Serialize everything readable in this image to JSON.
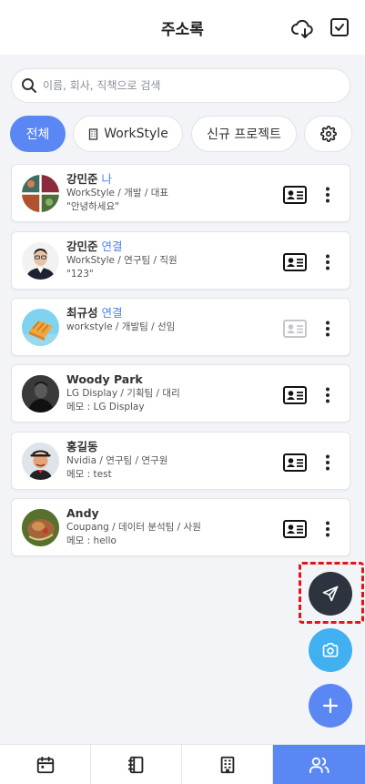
{
  "header": {
    "title": "주소록"
  },
  "search": {
    "placeholder": "이름, 회사, 직책으로 검색"
  },
  "filters": [
    {
      "label": "전체",
      "active": true
    },
    {
      "label": "WorkStyle",
      "icon": "building-icon",
      "active": false
    },
    {
      "label": "신규 프로젝트",
      "active": false
    },
    {
      "icon": "gear-icon",
      "active": false
    }
  ],
  "contacts": [
    {
      "name": "강민준",
      "tag": "나",
      "line1": "WorkStyle / 개발 / 대표",
      "line2": "\"안녕하세요\"",
      "avatar": "pattern",
      "card_enabled": true
    },
    {
      "name": "강민준",
      "tag": "연결",
      "line1": "WorkStyle / 연구팀 / 직원",
      "line2": "\"123\"",
      "avatar": "man-photo",
      "card_enabled": true
    },
    {
      "name": "최규성",
      "tag": "연결",
      "line1": "workstyle / 개발팀 / 선임",
      "line2": "",
      "avatar": "food-photo",
      "card_enabled": false
    },
    {
      "name": "Woody Park",
      "tag": "",
      "line1": "LG Display / 기획팀 / 대리",
      "line2": "메모 : LG Display",
      "avatar": "dark-photo",
      "card_enabled": true
    },
    {
      "name": "홍길동",
      "tag": "",
      "line1": "Nvidia / 연구팀 / 연구원",
      "line2": "메모 : test",
      "avatar": "cartoon",
      "card_enabled": true
    },
    {
      "name": "Andy",
      "tag": "",
      "line1": "Coupang / 데이터 분석팀 / 사원",
      "line2": "메모 : hello",
      "avatar": "dish-photo",
      "card_enabled": true
    }
  ],
  "fabs": [
    {
      "icon": "send-icon",
      "color": "#2d3440"
    },
    {
      "icon": "camera-icon",
      "color": "#40b0f0"
    },
    {
      "icon": "plus-icon",
      "color": "#5b87f4"
    }
  ],
  "tabs": [
    {
      "icon": "calendar-icon",
      "active": false
    },
    {
      "icon": "notebook-icon",
      "active": false
    },
    {
      "icon": "office-building-icon",
      "active": false
    },
    {
      "icon": "people-icon",
      "active": true
    }
  ],
  "colors": {
    "accent": "#5b87f4",
    "tag": "#4e7ff0",
    "highlight": "#e1141b"
  }
}
